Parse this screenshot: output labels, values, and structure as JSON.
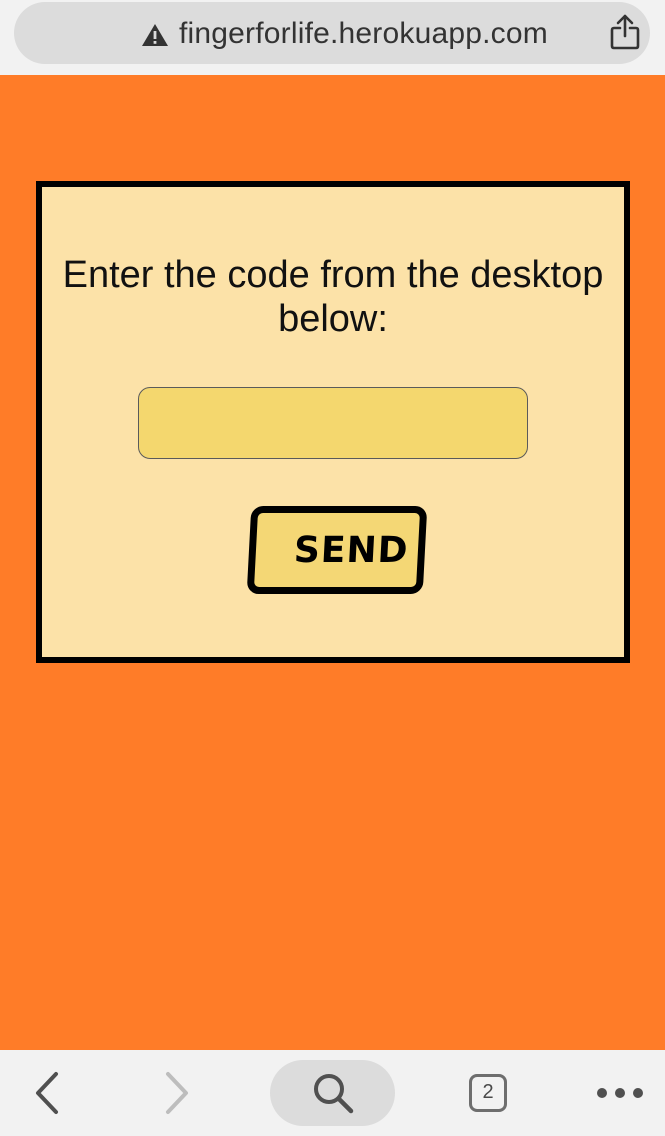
{
  "browser": {
    "url": "fingerforlife.herokuapp.com",
    "tab_count": "2"
  },
  "form": {
    "prompt": "Enter the code from the desktop below:",
    "code_value": "",
    "send_label": "SEND"
  },
  "colors": {
    "page_background": "#ff7c28",
    "card_background": "#fce2a8",
    "input_background": "#f4d76e",
    "button_background": "#f4d775",
    "border": "#000000",
    "browser_chrome": "#f2f2f2"
  },
  "icons": {
    "address_bar": [
      "warning-icon",
      "share-icon"
    ],
    "toolbar": [
      "back-icon",
      "forward-icon",
      "search-icon",
      "tabs-icon",
      "more-icon"
    ]
  }
}
